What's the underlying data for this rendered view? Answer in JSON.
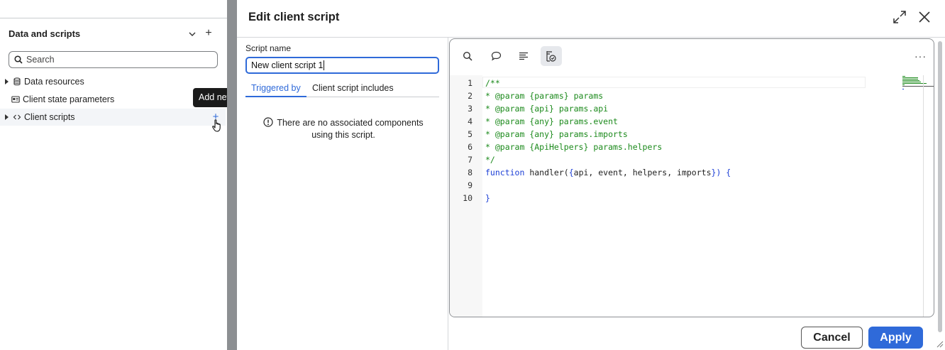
{
  "left_panel": {
    "title": "Data and scripts",
    "search": {
      "placeholder": "Search",
      "value": ""
    },
    "items": [
      {
        "label": "Data resources",
        "icon": "database-icon",
        "expandable": true
      },
      {
        "label": "Client state parameters",
        "icon": "id-card-icon",
        "expandable": false
      },
      {
        "label": "Client scripts",
        "icon": "code-brackets-icon",
        "expandable": true
      }
    ],
    "tooltip": "Add new"
  },
  "modal": {
    "title": "Edit client script",
    "script_name_label": "Script name",
    "script_name_value": "New client script 1",
    "tabs": [
      {
        "label": "Triggered by",
        "active": true
      },
      {
        "label": "Client script includes",
        "active": false
      }
    ],
    "empty_message": "There are no associated components using this script.",
    "toolbar": {
      "buttons": [
        "search-icon",
        "comment-icon",
        "format-icon",
        "script-check-icon"
      ],
      "more": "···"
    },
    "code_lines": [
      {
        "num": "1",
        "text": "/**"
      },
      {
        "num": "2",
        "text": "* @param {params} params"
      },
      {
        "num": "3",
        "text": "* @param {api} params.api"
      },
      {
        "num": "4",
        "text": "* @param {any} params.event"
      },
      {
        "num": "5",
        "text": "* @param {any} params.imports"
      },
      {
        "num": "6",
        "text": "* @param {ApiHelpers} params.helpers"
      },
      {
        "num": "7",
        "text": "*/"
      },
      {
        "num": "8",
        "kw": "function",
        "rest": " handler(",
        "brace": "{",
        "args": "api, event, helpers, imports",
        "brace2": "}",
        "tail": ") {"
      },
      {
        "num": "9",
        "text": ""
      },
      {
        "num": "10",
        "text": "}"
      }
    ],
    "cancel_label": "Cancel",
    "apply_label": "Apply"
  },
  "colors": {
    "accent": "#2f6ad9",
    "comment": "#1c8a1c",
    "keyword": "#1c3fd6",
    "backdrop": "#8c8f92"
  }
}
